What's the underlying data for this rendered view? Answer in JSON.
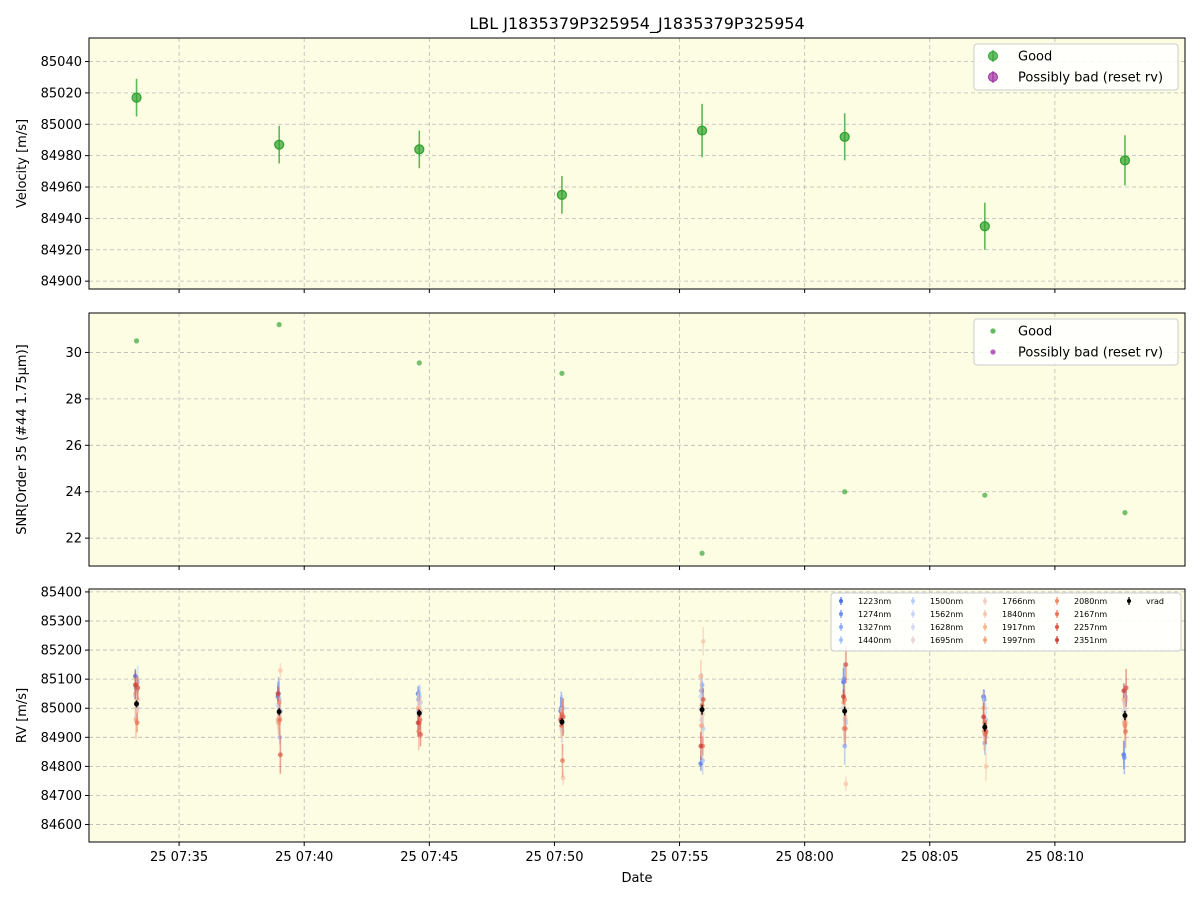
{
  "figure": {
    "title": "LBL J1835379P325954_J1835379P325954",
    "xlabel": "Date",
    "x_ticks": [
      "25 07:35",
      "25 07:40",
      "25 07:45",
      "25 07:50",
      "25 07:55",
      "25 08:00",
      "25 08:05",
      "25 08:10"
    ],
    "x_tick_minutes": [
      35,
      40,
      45,
      50,
      55,
      60,
      65,
      70
    ],
    "x_range_minutes": [
      31.4,
      75.2
    ],
    "background_color": "#fdfde3",
    "good_color": "#2ca02c",
    "bad_color": "#9b30a0"
  },
  "chart_data": [
    {
      "type": "scatter",
      "panel": "velocity",
      "ylabel": "Velocity [m/s]",
      "ylim": [
        84895,
        85055
      ],
      "y_ticks": [
        84900,
        84920,
        84940,
        84960,
        84980,
        85000,
        85020,
        85040
      ],
      "grid": true,
      "legend": {
        "placement": "top-right",
        "entries": [
          "Good",
          "Possibly bad (reset rv)"
        ]
      },
      "x_minutes": [
        33.3,
        39.0,
        44.6,
        50.3,
        55.9,
        61.6,
        67.2,
        72.8
      ],
      "series": [
        {
          "name": "Good",
          "y": [
            85017,
            84987,
            84984,
            84955,
            84996,
            84992,
            84935,
            84977
          ],
          "err": [
            12,
            12,
            12,
            12,
            17,
            15,
            15,
            16
          ]
        },
        {
          "name": "Possibly bad (reset rv)",
          "y": [],
          "err": []
        }
      ]
    },
    {
      "type": "scatter",
      "panel": "snr",
      "ylabel": "SNR[Order 35 (#44 1.75μm)]",
      "ylim": [
        20.8,
        31.7
      ],
      "y_ticks": [
        22,
        24,
        26,
        28,
        30
      ],
      "grid": true,
      "legend": {
        "placement": "top-right",
        "entries": [
          "Good",
          "Possibly bad (reset rv)"
        ]
      },
      "x_minutes": [
        33.3,
        39.0,
        44.6,
        50.3,
        55.9,
        61.6,
        67.2,
        72.8
      ],
      "series": [
        {
          "name": "Good",
          "y": [
            30.5,
            31.2,
            29.55,
            29.1,
            21.35,
            24.0,
            23.85,
            23.1
          ]
        },
        {
          "name": "Possibly bad (reset rv)",
          "y": []
        }
      ]
    },
    {
      "type": "scatter",
      "panel": "rv",
      "ylabel": "RV [m/s]",
      "ylim": [
        84540,
        85410
      ],
      "y_ticks": [
        84600,
        84700,
        84800,
        84900,
        85000,
        85100,
        85200,
        85300,
        85400
      ],
      "grid": true,
      "legend": {
        "placement": "top-right",
        "columns": 5,
        "entries": [
          "1223nm",
          "1274nm",
          "1327nm",
          "1440nm",
          "1500nm",
          "1562nm",
          "1628nm",
          "1695nm",
          "1766nm",
          "1840nm",
          "1917nm",
          "1997nm",
          "2080nm",
          "2167nm",
          "2257nm",
          "2351nm",
          "vrad"
        ]
      },
      "x_minutes": [
        33.3,
        39.0,
        44.6,
        50.3,
        55.9,
        61.6,
        67.2,
        72.8
      ],
      "vrad": {
        "y": [
          85015,
          84988,
          84983,
          84953,
          84995,
          84990,
          84935,
          84975
        ],
        "err": [
          12,
          12,
          12,
          12,
          17,
          15,
          15,
          16
        ]
      },
      "bands": [
        {
          "name": "1223nm",
          "color": "#4a6fe3",
          "y": [
            85110,
            85040,
            85050,
            84990,
            84810,
            85090,
            85040,
            84840
          ]
        },
        {
          "name": "1274nm",
          "color": "#6b8ff0",
          "y": [
            85070,
            85050,
            85030,
            85000,
            85060,
            85100,
            85030,
            84830
          ]
        },
        {
          "name": "1327nm",
          "color": "#8aabf7",
          "y": [
            85060,
            85030,
            85040,
            84980,
            85080,
            84870,
            84880,
            85020
          ]
        },
        {
          "name": "1440nm",
          "color": "#a3bffa",
          "y": [
            85000,
            84900,
            84960,
            84950,
            84820,
            84960,
            84900,
            85040
          ]
        },
        {
          "name": "1500nm",
          "color": "#b7cdfc",
          "y": [
            85090,
            84990,
            85020,
            85000,
            84930,
            84950,
            84960,
            85030
          ]
        },
        {
          "name": "1562nm",
          "color": "#c7d6f7",
          "y": [
            85040,
            85010,
            84990,
            84960,
            85040,
            85000,
            84970,
            84990
          ]
        },
        {
          "name": "1628nm",
          "color": "#d6dbec",
          "y": [
            84970,
            84960,
            84950,
            84930,
            84960,
            84930,
            84910,
            84960
          ]
        },
        {
          "name": "1695nm",
          "color": "#e2d8da",
          "y": [
            85010,
            84980,
            84980,
            84940,
            85000,
            84990,
            84950,
            84990
          ]
        },
        {
          "name": "1766nm",
          "color": "#eccfc3",
          "y": [
            84990,
            84970,
            84970,
            84920,
            84980,
            84970,
            84930,
            84970
          ]
        },
        {
          "name": "1840nm",
          "color": "#f5c4ab",
          "y": [
            85030,
            85130,
            84990,
            84760,
            85230,
            84740,
            84800,
            84950
          ]
        },
        {
          "name": "1917nm",
          "color": "#f7b494",
          "y": [
            85050,
            84960,
            85000,
            84970,
            85110,
            85020,
            85000,
            85030
          ]
        },
        {
          "name": "1997nm",
          "color": "#f5a07e",
          "y": [
            84960,
            84950,
            84920,
            84940,
            84940,
            84930,
            84920,
            84950
          ]
        },
        {
          "name": "2080nm",
          "color": "#ef8a6a",
          "y": [
            85080,
            85020,
            84950,
            84980,
            85010,
            85030,
            84950,
            84940
          ]
        },
        {
          "name": "2167nm",
          "color": "#e57358",
          "y": [
            84950,
            84960,
            84960,
            84820,
            84870,
            84930,
            84910,
            84920
          ]
        },
        {
          "name": "2257nm",
          "color": "#d95a48",
          "y": [
            85070,
            84840,
            84910,
            84970,
            85030,
            85150,
            84920,
            85070
          ]
        },
        {
          "name": "2351nm",
          "color": "#cc3f3a",
          "y": [
            85080,
            85050,
            84950,
            84960,
            84870,
            85040,
            84970,
            85060
          ]
        }
      ]
    }
  ]
}
